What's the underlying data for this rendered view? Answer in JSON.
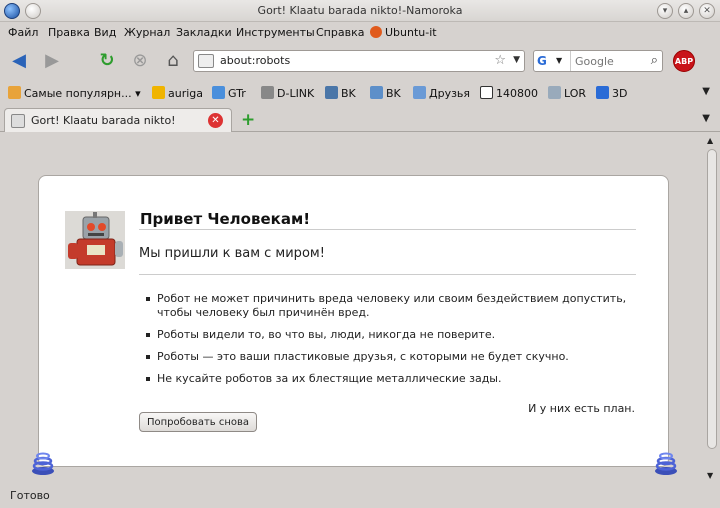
{
  "window": {
    "title": "Gort! Klaatu barada nikto!-Namoroka"
  },
  "menu": {
    "items": [
      "Файл",
      "Правка",
      "Вид",
      "Журнал",
      "Закладки",
      "Инструменты",
      "Справка",
      "Ubuntu-it"
    ]
  },
  "navbar": {
    "url": "about:robots",
    "search_placeholder": "Google"
  },
  "bookmarks": {
    "items": [
      "Самые популярн...",
      "auriga",
      "GTr",
      "D-LINK",
      "BK",
      "BK",
      "Друзья",
      "140800",
      "LOR",
      "3D"
    ]
  },
  "tabs": [
    {
      "label": "Gort! Klaatu barada nikto!"
    }
  ],
  "page": {
    "heading": "Привет Человекам!",
    "subtitle": "Мы пришли к вам с миром!",
    "laws": [
      "Робот не может причинить вреда человеку или своим бездействием допустить, чтобы человеку был причинён вред.",
      "Роботы видели то, во что вы, люди, никогда не поверите.",
      "Роботы — это ваши пластиковые друзья, с которыми не будет скучно.",
      "Не кусайте роботов за их блестящие металлические зады."
    ],
    "plan_text": "И у них есть план.",
    "retry_label": "Попробовать снова"
  },
  "status": {
    "text": "Готово"
  },
  "colors": {
    "chrome": "#d6d2cf",
    "abp": "#c9141a",
    "newtab": "#2e9d2e"
  }
}
